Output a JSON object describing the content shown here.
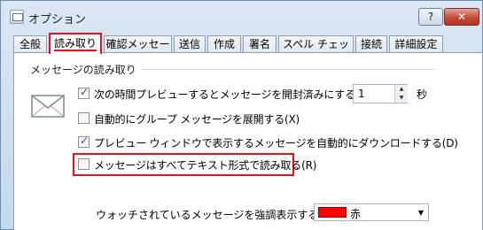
{
  "window": {
    "title": "オプション"
  },
  "titlebar": {
    "help_label": "?",
    "close_label": "✕"
  },
  "tabs": [
    {
      "label": "全般"
    },
    {
      "label": "読み取り",
      "active": true
    },
    {
      "label": "確認メッセージ"
    },
    {
      "label": "送信"
    },
    {
      "label": "作成"
    },
    {
      "label": "署名"
    },
    {
      "label": "スペル チェック"
    },
    {
      "label": "接続"
    },
    {
      "label": "詳細設定"
    }
  ],
  "section": {
    "title": "メッセージの読み取り"
  },
  "options": [
    {
      "label": "次の時間プレビューするとメッセージを開封済みにする(M)",
      "checked": true
    },
    {
      "label": "自動的にグループ メッセージを展開する(X)",
      "checked": false
    },
    {
      "label": "プレビュー ウィンドウで表示するメッセージを自動的にダウンロードする(D)",
      "checked": true
    },
    {
      "label": "メッセージはすべてテキスト形式で読み取る(R)",
      "checked": false
    }
  ],
  "preview_time": {
    "value": "1",
    "unit": "秒"
  },
  "watched": {
    "label": "ウォッチされているメッセージを強調表示する",
    "color_name": "赤",
    "color": "#ff0000"
  },
  "icons": [
    "envelope-icon",
    "checkbox-icon",
    "dropdown-arrow-icon"
  ]
}
